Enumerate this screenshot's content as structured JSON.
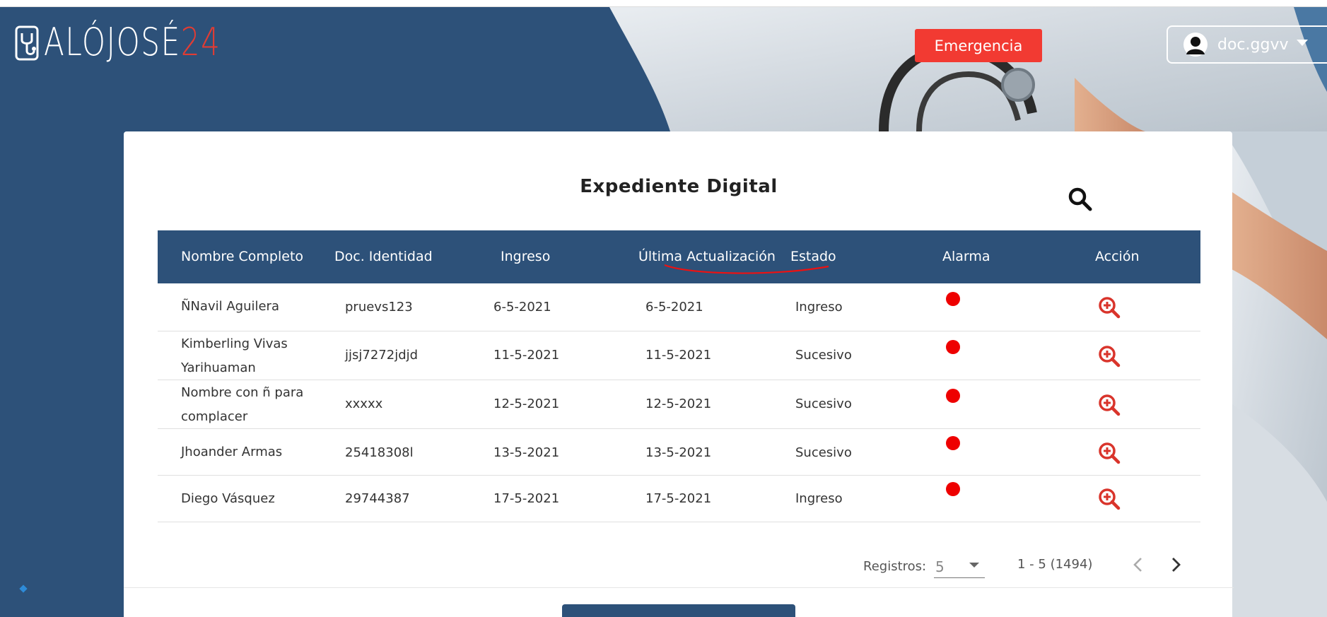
{
  "header": {
    "logo_text": "ALÓJOSÉ",
    "logo_number": "24",
    "emergency_label": "Emergencia",
    "user_name": "doc.ggvv"
  },
  "card": {
    "title": "Expediente Digital"
  },
  "table": {
    "headers": [
      "Nombre Completo",
      "Doc. Identidad",
      "Ingreso",
      "Última Actualización",
      "Estado",
      "Alarma",
      "Acción"
    ],
    "rows": [
      {
        "name": "ÑNavil Aguilera",
        "doc": "pruevs123",
        "ingreso": "6-5-2021",
        "actualizacion": "6-5-2021",
        "estado": "Ingreso"
      },
      {
        "name": "Kimberling Vivas Yarihuaman",
        "doc": "jjsj7272jdjd",
        "ingreso": "11-5-2021",
        "actualizacion": "11-5-2021",
        "estado": "Sucesivo"
      },
      {
        "name": "Nombre con ñ para complacer",
        "doc": "xxxxx",
        "ingreso": "12-5-2021",
        "actualizacion": "12-5-2021",
        "estado": "Sucesivo"
      },
      {
        "name": "Jhoander Armas",
        "doc": "25418308l",
        "ingreso": "13-5-2021",
        "actualizacion": "13-5-2021",
        "estado": "Sucesivo"
      },
      {
        "name": "Diego Vásquez",
        "doc": "29744387",
        "ingreso": "17-5-2021",
        "actualizacion": "17-5-2021",
        "estado": "Ingreso"
      }
    ]
  },
  "pagination": {
    "registros_label": "Registros:",
    "registros_value": "5",
    "range_text": "1 - 5 (1494)"
  },
  "colors": {
    "primary": "#2d5179",
    "emergency": "#f23a32",
    "alarm": "#ee0000",
    "action_icon": "#d9342b"
  },
  "icons": {
    "logo": "stethoscope-phone-icon",
    "avatar": "user-silhouette-icon",
    "search": "search-icon",
    "alarm": "red-dot-icon",
    "action": "zoom-in-icon",
    "prev": "chevron-left-icon",
    "next": "chevron-right-icon"
  }
}
